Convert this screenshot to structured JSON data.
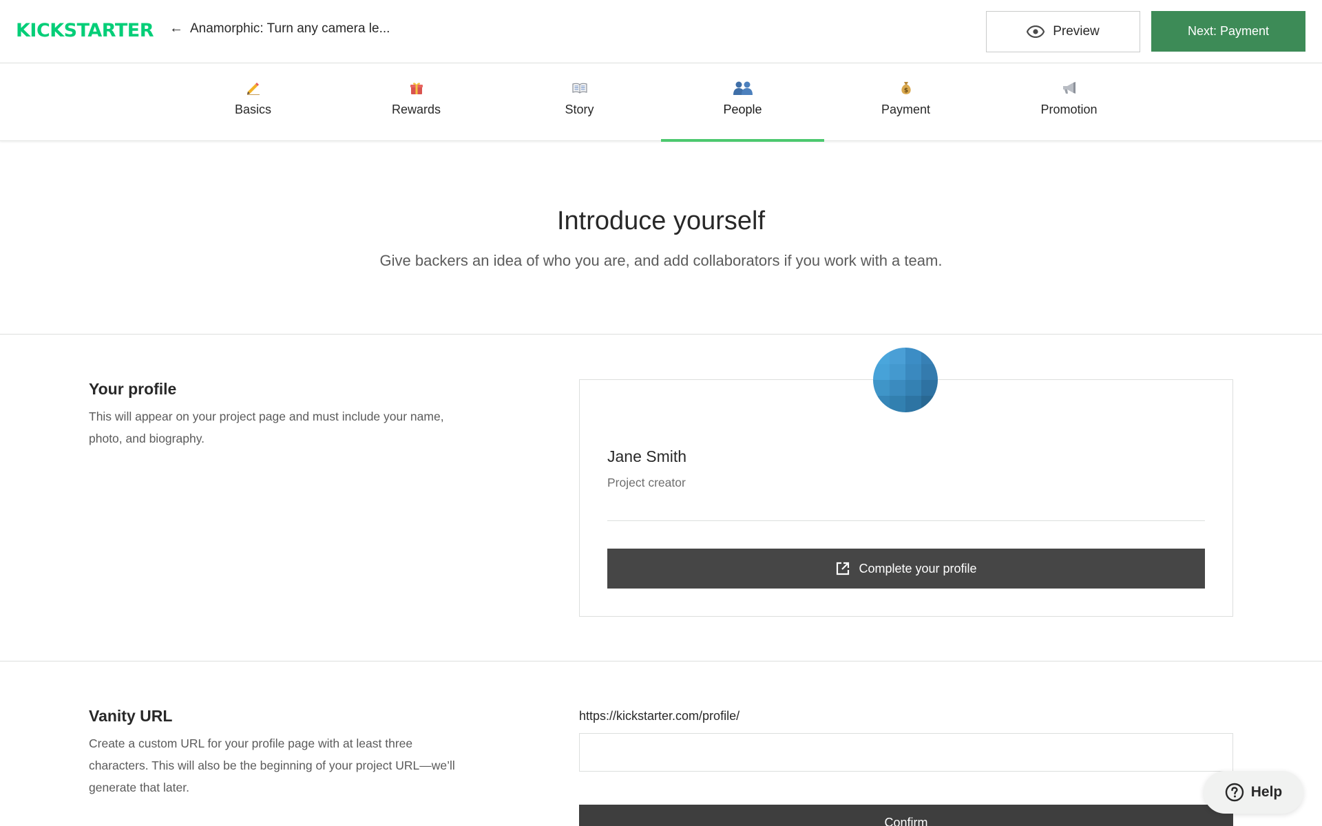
{
  "header": {
    "logo_text": "KICKSTARTER",
    "back_arrow": "←",
    "back_label": "Anamorphic: Turn any camera le...",
    "preview_label": "Preview",
    "next_label": "Next: Payment"
  },
  "tabs": [
    {
      "label": "Basics",
      "icon": "pencil-icon",
      "active": false
    },
    {
      "label": "Rewards",
      "icon": "gift-icon",
      "active": false
    },
    {
      "label": "Story",
      "icon": "book-icon",
      "active": false
    },
    {
      "label": "People",
      "icon": "people-icon",
      "active": true
    },
    {
      "label": "Payment",
      "icon": "money-bag-icon",
      "active": false
    },
    {
      "label": "Promotion",
      "icon": "megaphone-icon",
      "active": false
    }
  ],
  "intro": {
    "title": "Introduce yourself",
    "subtitle": "Give backers an idea of who you are, and add collaborators if you work with a team."
  },
  "profile_section": {
    "title": "Your profile",
    "description": "This will appear on your project page and must include your name, photo, and biography.",
    "card": {
      "name": "Jane Smith",
      "role": "Project creator",
      "complete_button": "Complete your profile"
    }
  },
  "vanity_section": {
    "title": "Vanity URL",
    "description": "Create a custom URL for your profile page with at least three characters. This will also be the beginning of your project URL—we’ll generate that later.",
    "url_prefix": "https://kickstarter.com/profile/",
    "input_value": "",
    "confirm_button": "Confirm"
  },
  "help": {
    "label": "Help"
  },
  "colors": {
    "brand_green": "#05ce78",
    "next_button": "#3d8b57",
    "tab_underline": "#4cc86f",
    "dark_button": "#464646"
  }
}
